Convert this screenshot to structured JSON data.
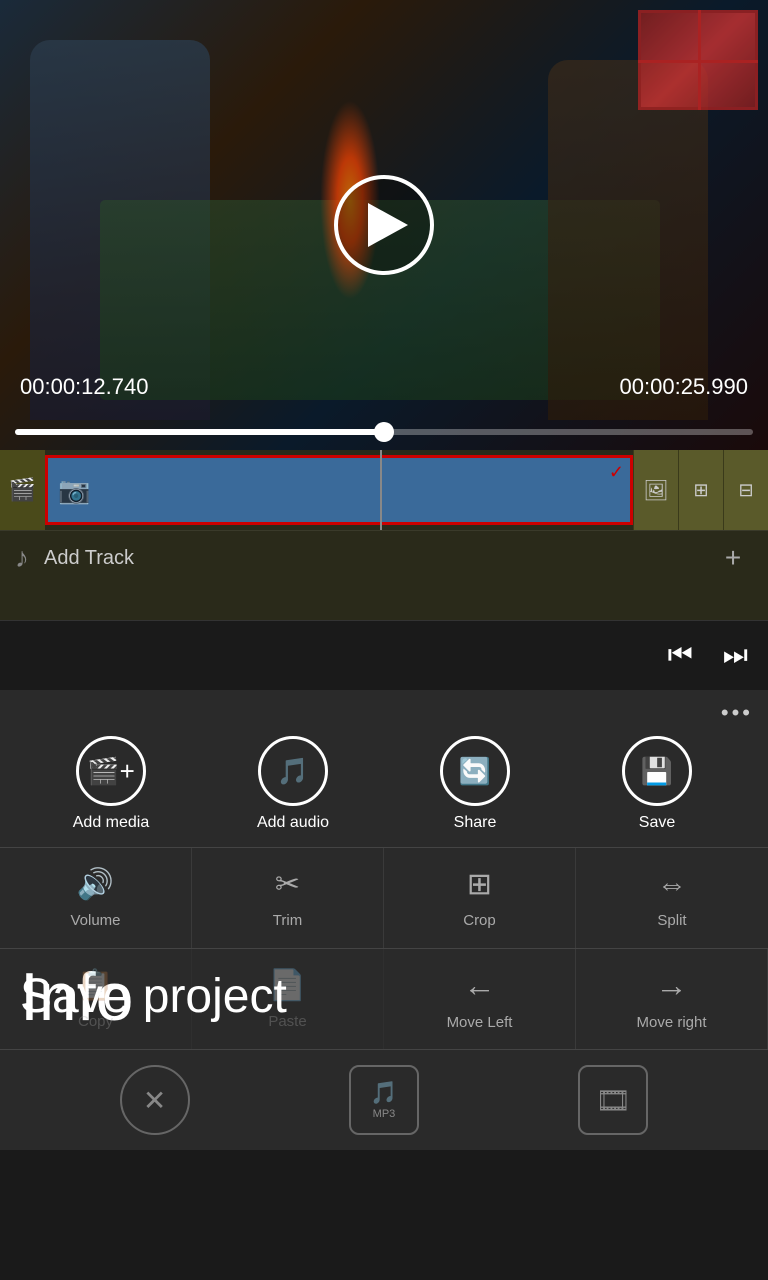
{
  "video": {
    "time_current": "00:00:12.740",
    "time_total": "00:00:25.990",
    "progress_percent": 50
  },
  "timeline": {
    "track_icon": "🎥",
    "add_track_label": "Add Track",
    "checkmark": "✓"
  },
  "toolbar": {
    "more_label": "•••",
    "items": [
      {
        "id": "add-media",
        "label": "Add media",
        "icon": "🎬"
      },
      {
        "id": "add-audio",
        "label": "Add audio",
        "icon": "🎵"
      },
      {
        "id": "share",
        "label": "Share",
        "icon": "🔄"
      },
      {
        "id": "save",
        "label": "Save",
        "icon": "💾"
      }
    ]
  },
  "grid": {
    "row1": [
      {
        "id": "volume",
        "label": "Volume",
        "icon": "🔊"
      },
      {
        "id": "trim",
        "label": "Trim",
        "icon": "✂"
      },
      {
        "id": "crop",
        "label": "Crop",
        "icon": "⊞"
      },
      {
        "id": "split",
        "label": "Split",
        "icon": "⇔"
      }
    ],
    "row2": [
      {
        "id": "info",
        "label": "Info",
        "icon": "ℹ"
      },
      {
        "id": "copy",
        "label": "Copy",
        "icon": "📋"
      },
      {
        "id": "paste",
        "label": "Paste",
        "icon": "📋"
      },
      {
        "id": "move-left",
        "label": "Move Left",
        "icon": "←"
      },
      {
        "id": "move-right",
        "label": "Move right",
        "icon": "→"
      }
    ],
    "row3": [
      {
        "id": "delete",
        "label": "",
        "icon": "✕"
      },
      {
        "id": "mp3",
        "label": "",
        "icon": "🎵"
      },
      {
        "id": "film",
        "label": "",
        "icon": "🎞"
      }
    ]
  },
  "overlay": {
    "info_label": "Info",
    "save_project_label": "Save project"
  }
}
